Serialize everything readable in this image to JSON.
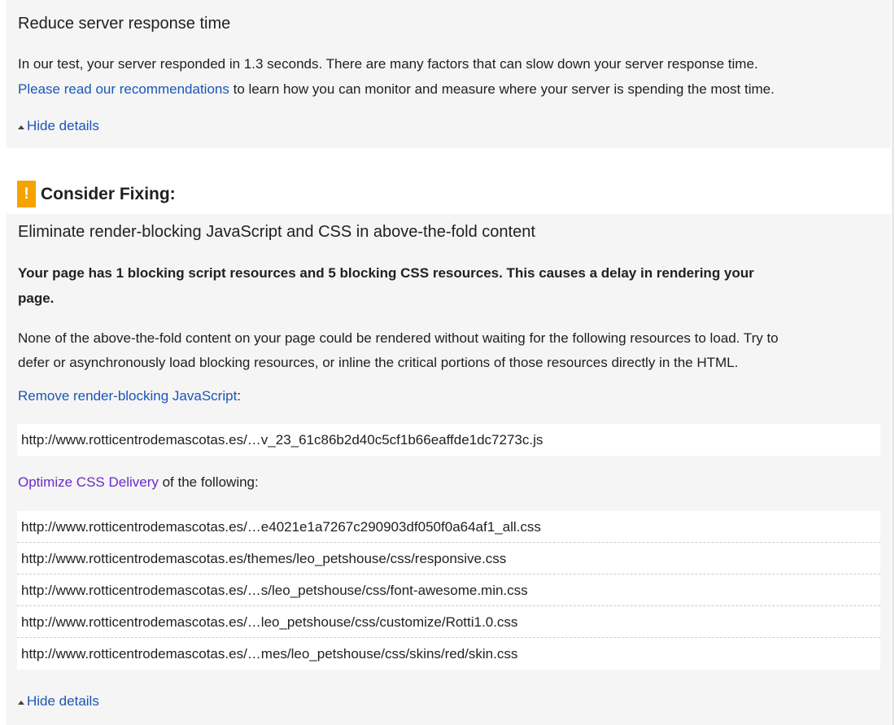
{
  "section1": {
    "title": "Reduce server response time",
    "para_line1": "In our test, your server responded in 1.3 seconds. There are many factors that can slow down your server response time.",
    "para_link": "Please read our recommendations",
    "para_line2_rest": " to learn how you can monitor and measure where your server is spending the most time.",
    "hide_details": "Hide details"
  },
  "consider": {
    "icon_glyph": "!",
    "icon_name": "warning-icon",
    "accent": "#f4a300",
    "title": "Consider Fixing:"
  },
  "section2": {
    "title": "Eliminate render-blocking JavaScript and CSS in above-the-fold content",
    "bold_line1": "Your page has 1 blocking script resources and 5 blocking CSS resources. This causes a delay in rendering your",
    "bold_line2": "page.",
    "desc_line1": "None of the above-the-fold content on your page could be rendered without waiting for the following resources to load. Try to",
    "desc_line2": "defer or asynchronously load blocking resources, or inline the critical portions of those resources directly in the HTML.",
    "js_link": "Remove render-blocking JavaScript",
    "js_link_suffix": ":",
    "js_urls": [
      "http://www.rotticentrodemascotas.es/…v_23_61c86b2d40c5cf1b66eaffde1dc7273c.js"
    ],
    "css_link": "Optimize CSS Delivery",
    "css_link_suffix": " of the following:",
    "css_urls": [
      "http://www.rotticentrodemascotas.es/…e4021e1a7267c290903df050f0a64af1_all.css",
      "http://www.rotticentrodemascotas.es/themes/leo_petshouse/css/responsive.css",
      "http://www.rotticentrodemascotas.es/…s/leo_petshouse/css/font-awesome.min.css",
      "http://www.rotticentrodemascotas.es/…leo_petshouse/css/customize/Rotti1.0.css",
      "http://www.rotticentrodemascotas.es/…mes/leo_petshouse/css/skins/red/skin.css"
    ],
    "hide_details": "Hide details"
  },
  "colors": {
    "link": "#1a56b8",
    "visited_link": "#6b2bc8",
    "panel_bg": "#f5f5f5"
  }
}
